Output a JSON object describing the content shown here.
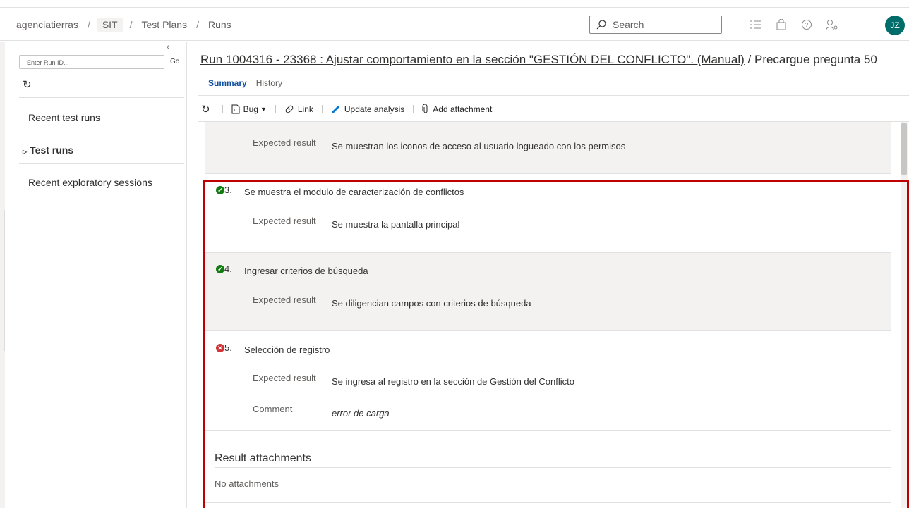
{
  "header": {
    "breadcrumb": [
      "agenciatierras",
      "SIT",
      "Test Plans",
      "Runs"
    ],
    "search_placeholder": "Search",
    "icons": [
      "list-icon",
      "shopping-bag-icon",
      "help-icon",
      "user-settings-icon"
    ],
    "avatar_initials": "JZ"
  },
  "sidebar": {
    "run_input_placeholder": "Enter Run ID...",
    "go_label": "Go",
    "items": [
      {
        "label": "Recent test runs"
      },
      {
        "label": "Test runs"
      },
      {
        "label": "Recent exploratory sessions"
      }
    ]
  },
  "main": {
    "title_link": "Run 1004316 - 23368 : Ajustar comportamiento en la sección \"GESTIÓN DEL CONFLICTO\". (Manual)",
    "title_suffix": " / Precargue pregunta 50",
    "tabs": [
      {
        "label": "Summary"
      },
      {
        "label": "History"
      }
    ],
    "toolbar": {
      "bug_label": "Bug",
      "link_label": "Link",
      "update_label": "Update analysis",
      "attach_label": "Add attachment"
    },
    "labels": {
      "expected": "Expected result",
      "comment": "Comment"
    },
    "prev_expected": "Se muestran los iconos de acceso al usuario logueado con los permisos",
    "steps": [
      {
        "num": "3.",
        "title": "Se muestra el modulo de caracterización de conflictos",
        "expected": "Se muestra la pantalla principal",
        "status": "pass"
      },
      {
        "num": "4.",
        "title": "Ingresar criterios de búsqueda",
        "expected": "Se diligencian campos con criterios de búsqueda",
        "status": "pass"
      },
      {
        "num": "5.",
        "title": "Selección de registro",
        "expected": "Se ingresa al registro en la sección de Gestión del Conflicto",
        "comment": "error de carga",
        "status": "fail"
      }
    ],
    "result_attachments_title": "Result attachments",
    "no_attachments": "No attachments"
  },
  "colors": {
    "accent": "#0f4e9f",
    "pass": "#107c10",
    "fail": "#d13438",
    "highlight": "#c00000",
    "avatar": "#006d6a"
  }
}
